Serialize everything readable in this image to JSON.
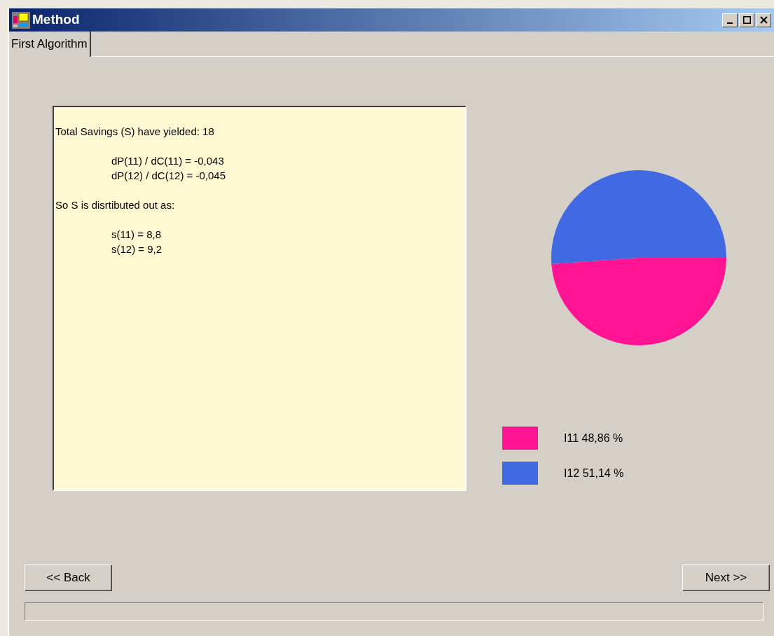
{
  "window": {
    "title": "Method"
  },
  "tabs": [
    {
      "label": "First Algorithm",
      "selected": true
    }
  ],
  "report": {
    "paragraphs": [
      {
        "indented": false,
        "lines": [
          "Total Savings (S) have yielded: 18"
        ]
      },
      {
        "indented": true,
        "lines": [
          "dP(11) / dC(11) = -0,043",
          "dP(12) / dC(12) = -0,045"
        ]
      },
      {
        "indented": false,
        "lines": [
          "So S is disrtibuted out as:"
        ]
      },
      {
        "indented": true,
        "lines": [
          "s(11) = 8,8",
          "s(12) = 9,2"
        ]
      }
    ]
  },
  "chart": {
    "chart_data": {
      "type": "pie",
      "categories": [
        "I11 48,86 %",
        "I12 51,14 %"
      ],
      "values": [
        48.86,
        51.14
      ]
    },
    "slices": [
      {
        "color": "#ff1493"
      },
      {
        "color": "#4169e1"
      }
    ]
  },
  "buttons": {
    "back": "<< Back",
    "next": "Next >>"
  },
  "progress": {
    "level": 0
  }
}
